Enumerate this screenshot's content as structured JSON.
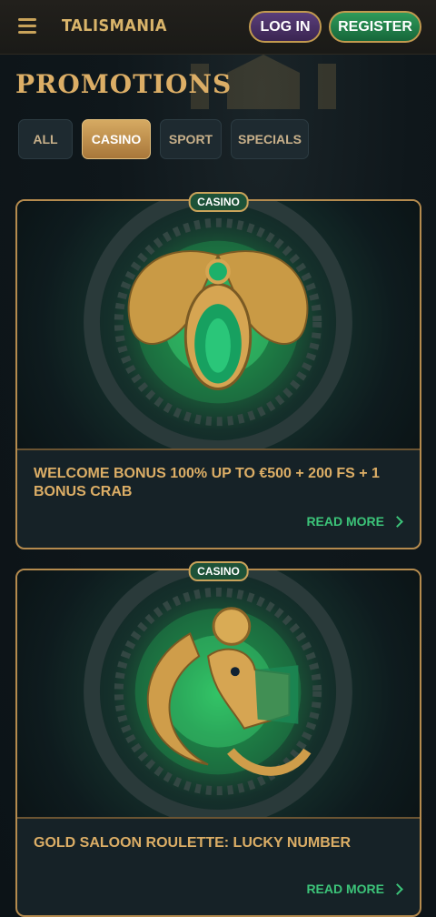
{
  "header": {
    "logo": "TALISMANIA",
    "login_label": "LOG IN",
    "register_label": "REGISTER",
    "menu_icon": "hamburger-menu-icon"
  },
  "page_title": "PROMOTIONS",
  "tabs": [
    {
      "label": "ALL",
      "active": false
    },
    {
      "label": "CASINO",
      "active": true
    },
    {
      "label": "SPORT",
      "active": false
    },
    {
      "label": "SPECIALS",
      "active": false
    }
  ],
  "promotions": [
    {
      "badge": "CASINO",
      "title": "WELCOME BONUS 100% UP TO €500 + 200 FS + 1 BONUS CRAB",
      "cta": "READ MORE",
      "image": "scarab-emblem"
    },
    {
      "badge": "CASINO",
      "title": "GOLD SALOON ROULETTE: LUCKY NUMBER",
      "cta": "READ MORE",
      "image": "horus-falcon-emblem"
    }
  ],
  "colors": {
    "gold": "#dcae66",
    "green_accent": "#3cc479",
    "login_purple": "#4a3166",
    "register_green": "#1f8a4c",
    "active_tab": "#c4924f"
  }
}
